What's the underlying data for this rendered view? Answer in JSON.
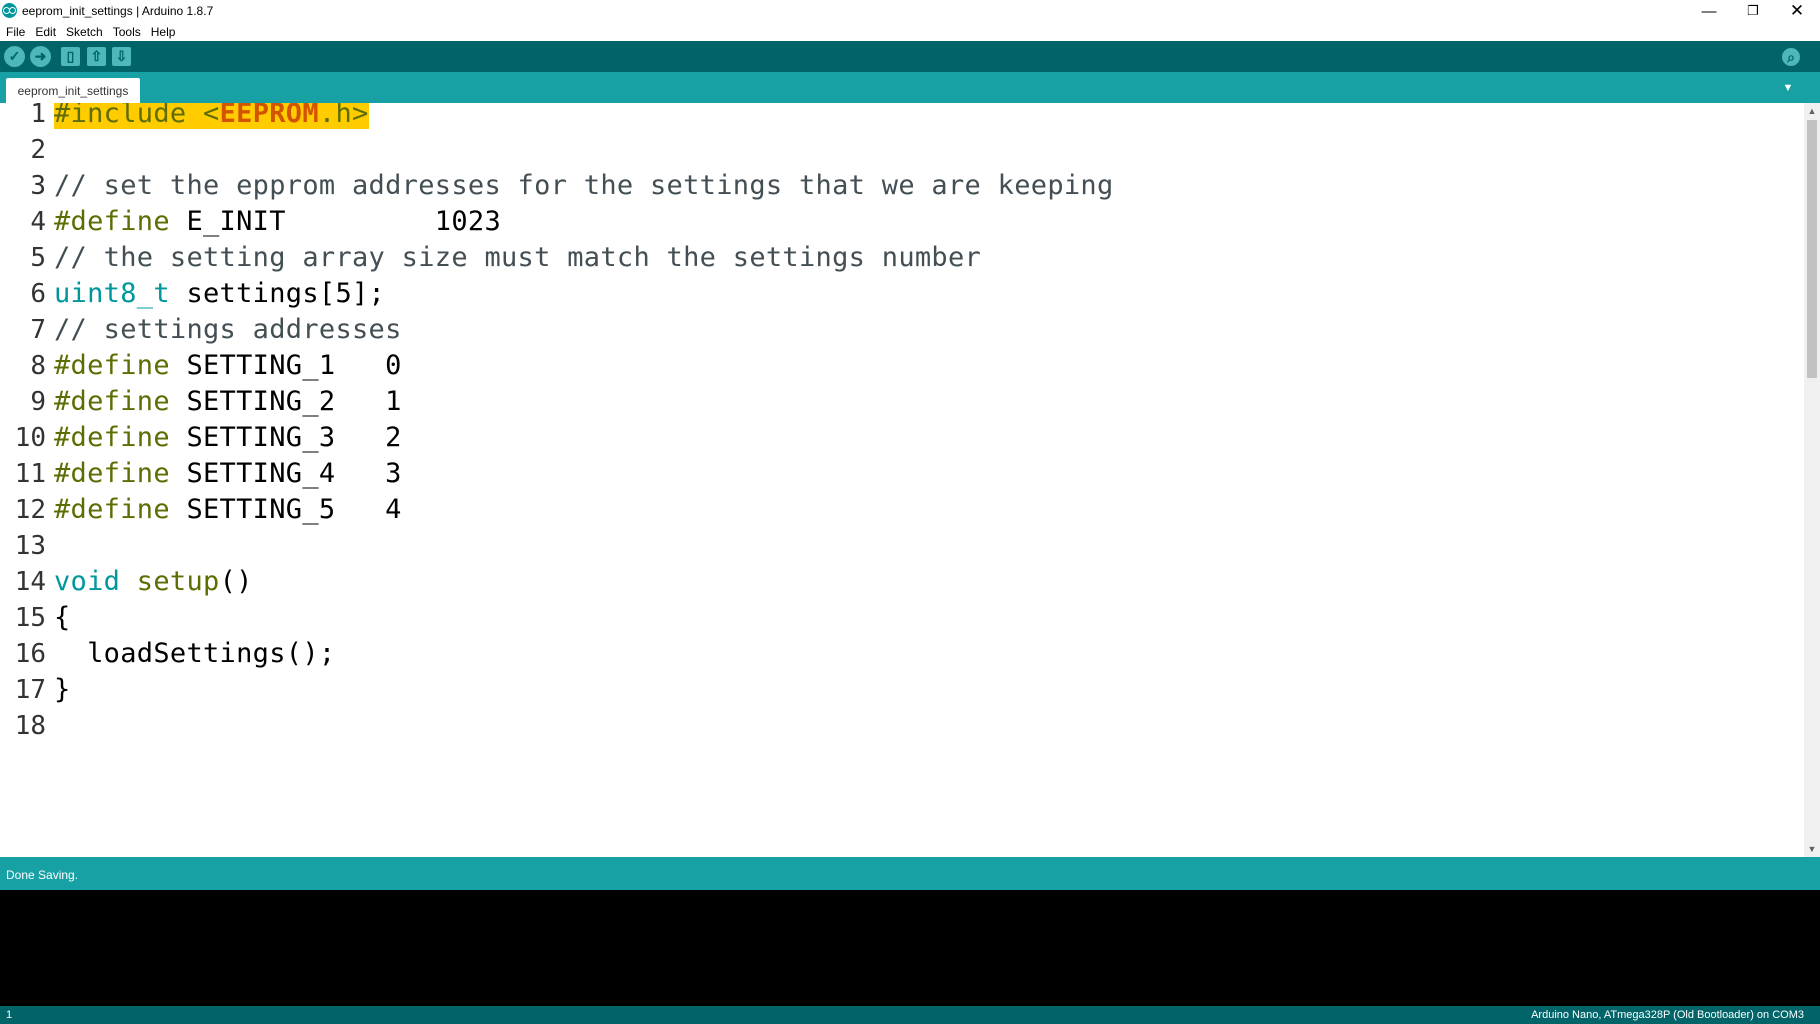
{
  "window": {
    "title": "eeprom_init_settings | Arduino 1.8.7",
    "minimize": "—",
    "maximize": "❐",
    "close": "✕"
  },
  "menu": [
    "File",
    "Edit",
    "Sketch",
    "Tools",
    "Help"
  ],
  "toolbar": {
    "verify": "✓",
    "upload": "➜",
    "new": "▯",
    "open": "⇧",
    "save": "⇩",
    "serial_monitor": "⌕"
  },
  "tabs": [
    {
      "label": "eeprom_init_settings"
    }
  ],
  "tab_menu": "▼",
  "editor": {
    "lines": [
      {
        "n": "1",
        "segments": [
          {
            "t": "#include",
            "c": "kw-pre hl"
          },
          {
            "t": " ",
            "c": "hl"
          },
          {
            "t": "<",
            "c": "kw-pre hl"
          },
          {
            "t": "EEPROM",
            "c": "kw-lib hl"
          },
          {
            "t": ".h>",
            "c": "kw-pre hl"
          }
        ]
      },
      {
        "n": "2",
        "segments": []
      },
      {
        "n": "3",
        "segments": [
          {
            "t": "// set the epprom addresses for the settings that we are keeping",
            "c": "cmt"
          }
        ]
      },
      {
        "n": "4",
        "segments": [
          {
            "t": "#define",
            "c": "kw-pre"
          },
          {
            "t": " E_INIT         1023",
            "c": ""
          }
        ]
      },
      {
        "n": "5",
        "segments": [
          {
            "t": "// the setting array size must match the settings number",
            "c": "cmt"
          }
        ]
      },
      {
        "n": "6",
        "segments": [
          {
            "t": "uint8_t",
            "c": "kw-type"
          },
          {
            "t": " settings[5];",
            "c": ""
          }
        ]
      },
      {
        "n": "7",
        "segments": [
          {
            "t": "// settings addresses",
            "c": "cmt"
          }
        ]
      },
      {
        "n": "8",
        "segments": [
          {
            "t": "#define",
            "c": "kw-pre"
          },
          {
            "t": " SETTING_1   0",
            "c": ""
          }
        ]
      },
      {
        "n": "9",
        "segments": [
          {
            "t": "#define",
            "c": "kw-pre"
          },
          {
            "t": " SETTING_2   1",
            "c": ""
          }
        ]
      },
      {
        "n": "10",
        "segments": [
          {
            "t": "#define",
            "c": "kw-pre"
          },
          {
            "t": " SETTING_3   2",
            "c": ""
          }
        ]
      },
      {
        "n": "11",
        "segments": [
          {
            "t": "#define",
            "c": "kw-pre"
          },
          {
            "t": " SETTING_4   3",
            "c": ""
          }
        ]
      },
      {
        "n": "12",
        "segments": [
          {
            "t": "#define",
            "c": "kw-pre"
          },
          {
            "t": " SETTING_5   4",
            "c": ""
          }
        ]
      },
      {
        "n": "13",
        "segments": []
      },
      {
        "n": "14",
        "segments": [
          {
            "t": "void",
            "c": "kw-type"
          },
          {
            "t": " ",
            "c": ""
          },
          {
            "t": "setup",
            "c": "kw-fn"
          },
          {
            "t": "()",
            "c": ""
          }
        ]
      },
      {
        "n": "15",
        "segments": [
          {
            "t": "{",
            "c": ""
          }
        ]
      },
      {
        "n": "16",
        "segments": [
          {
            "t": "  loadSettings();",
            "c": ""
          }
        ]
      },
      {
        "n": "17",
        "segments": [
          {
            "t": "}",
            "c": ""
          }
        ]
      },
      {
        "n": "18",
        "segments": []
      }
    ]
  },
  "scroll": {
    "up": "▲",
    "down": "▼"
  },
  "status": {
    "message": "Done Saving."
  },
  "footer": {
    "line": "1",
    "board": "Arduino Nano, ATmega328P (Old Bootloader) on COM3"
  },
  "colors": {
    "toolbar": "#006468",
    "tabbar": "#17a1a5",
    "highlight": "#ffcc00",
    "keyword": "#5e6d03",
    "type": "#00979c",
    "library": "#d35400"
  }
}
